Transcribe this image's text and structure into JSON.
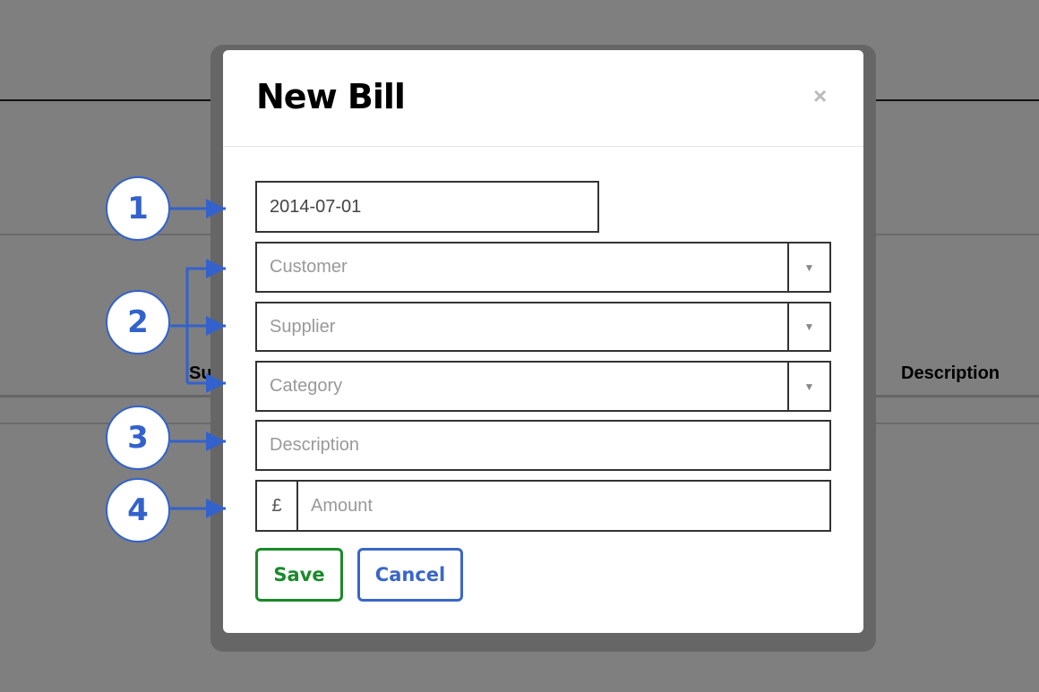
{
  "background": {
    "column_headers": [
      "Sup",
      "Description"
    ]
  },
  "modal": {
    "title": "New Bill",
    "close_icon": "×",
    "date_value": "2014-07-01",
    "customer_placeholder": "Customer",
    "supplier_placeholder": "Supplier",
    "category_placeholder": "Category",
    "description_placeholder": "Description",
    "currency_symbol": "£",
    "amount_placeholder": "Amount",
    "save_label": "Save",
    "cancel_label": "Cancel",
    "dropdown_icon": "▼"
  },
  "callouts": [
    "1",
    "2",
    "3",
    "4"
  ],
  "colors": {
    "callout": "#3362cc",
    "save": "#1a8a2a",
    "cancel": "#3a66c8"
  }
}
